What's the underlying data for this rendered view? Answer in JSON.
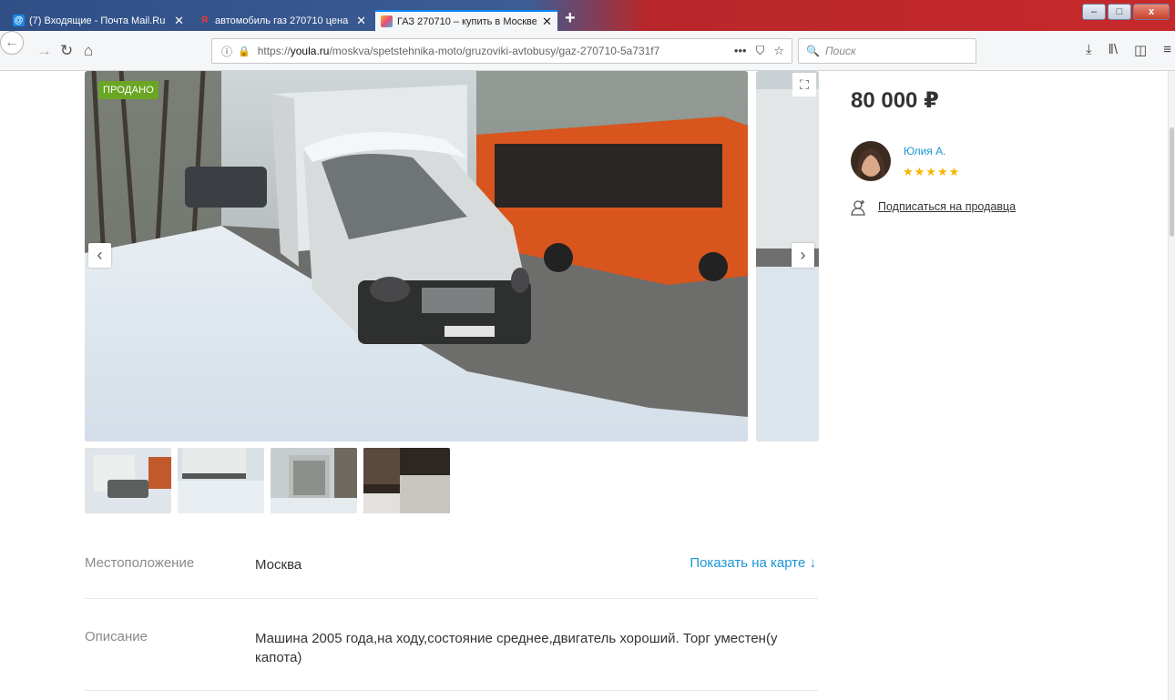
{
  "browser": {
    "tabs": [
      {
        "title": "(7) Входящие - Почта Mail.Ru",
        "close": "✕"
      },
      {
        "title": "автомобиль газ 270710 цена -",
        "close": "✕"
      },
      {
        "title": "ГАЗ 270710 – купить в Москве",
        "close": "✕"
      }
    ],
    "new_tab": "+",
    "window_buttons": {
      "minimize": "–",
      "maximize": "□",
      "close": "x"
    },
    "url_prefix": "https://",
    "url_domain": "youla.ru",
    "url_path": "/moskva/spetstehnika-moto/gruzoviki-avtobusy/gaz-270710-5a731f7",
    "url_actions": {
      "more": "•••",
      "pocket": "⛉",
      "bookmark": "☆"
    },
    "search_placeholder": "Поиск",
    "colors": {
      "tabstrip_left": "#2f4f86",
      "tabstrip_right": "#c7292b",
      "accent": "#0a84ff"
    }
  },
  "listing": {
    "sold_badge": "ПРОДАНО",
    "arrow_prev": "‹",
    "arrow_next": "›",
    "fullscreen": "⛶",
    "price": "80 000 ₽",
    "seller": {
      "name": "Юлия А.",
      "rating_stars": "★★★★★"
    },
    "subscribe_icon": "👤",
    "subscribe_label": "Подписаться на продавца",
    "location": {
      "label": "Местоположение",
      "value": "Москва",
      "map_link": "Показать на карте ↓"
    },
    "description": {
      "label": "Описание",
      "value": "Машина 2005 года,на ходу,состояние среднее,двигатель хороший. Торг уместен(у капота)"
    },
    "colors": {
      "sold_badge": "#6aa624",
      "link": "#1a96d4",
      "stars": "#f7b500"
    }
  }
}
